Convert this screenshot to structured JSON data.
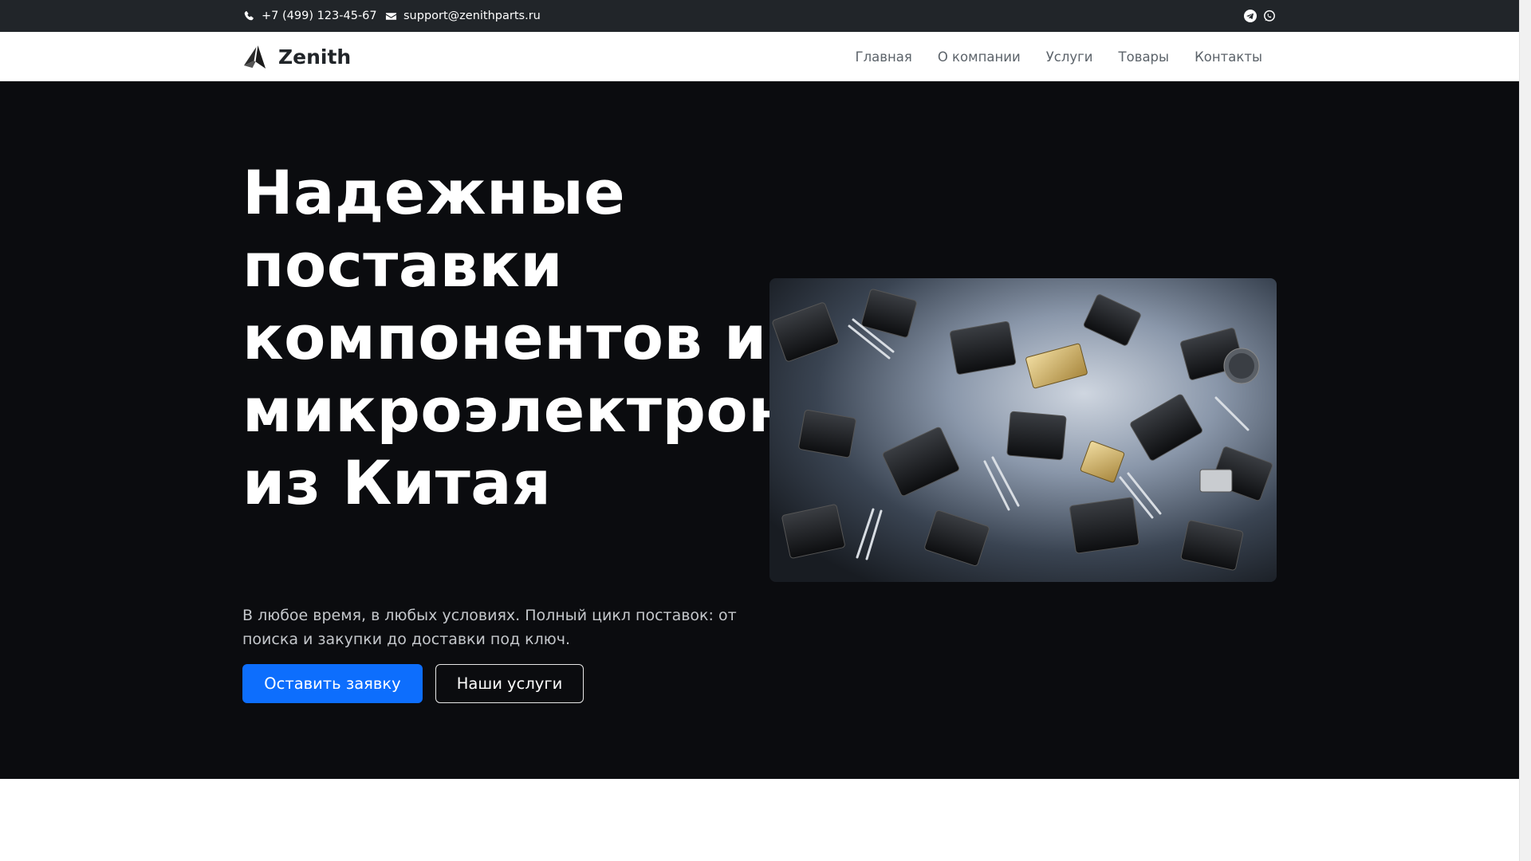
{
  "topbar": {
    "phone": "+7 (499) 123-45-67",
    "email": "support@zenithparts.ru",
    "icons": {
      "phone": "phone-icon",
      "email": "envelope-icon",
      "telegram": "telegram-icon",
      "whatsapp": "whatsapp-icon"
    }
  },
  "navbar": {
    "brand": "Zenith",
    "logo": "zenith-logo",
    "items": [
      {
        "label": "Главная"
      },
      {
        "label": "О компании"
      },
      {
        "label": "Услуги"
      },
      {
        "label": "Товары"
      },
      {
        "label": "Контакты"
      }
    ]
  },
  "hero": {
    "title": "Надежные поставки компонентов и микроэлектроники из Китая",
    "lead": "В любое время, в любых условиях. Полный цикл поставок: от поиска и закупки до доставки под ключ.",
    "primary_button": "Оставить заявку",
    "secondary_button": "Наши услуги",
    "image": "electronic-components-photo"
  },
  "colors": {
    "topbar_bg": "#212529",
    "hero_bg": "#0b0c0f",
    "primary": "#0d6efd",
    "nav_text": "#5c636a"
  }
}
